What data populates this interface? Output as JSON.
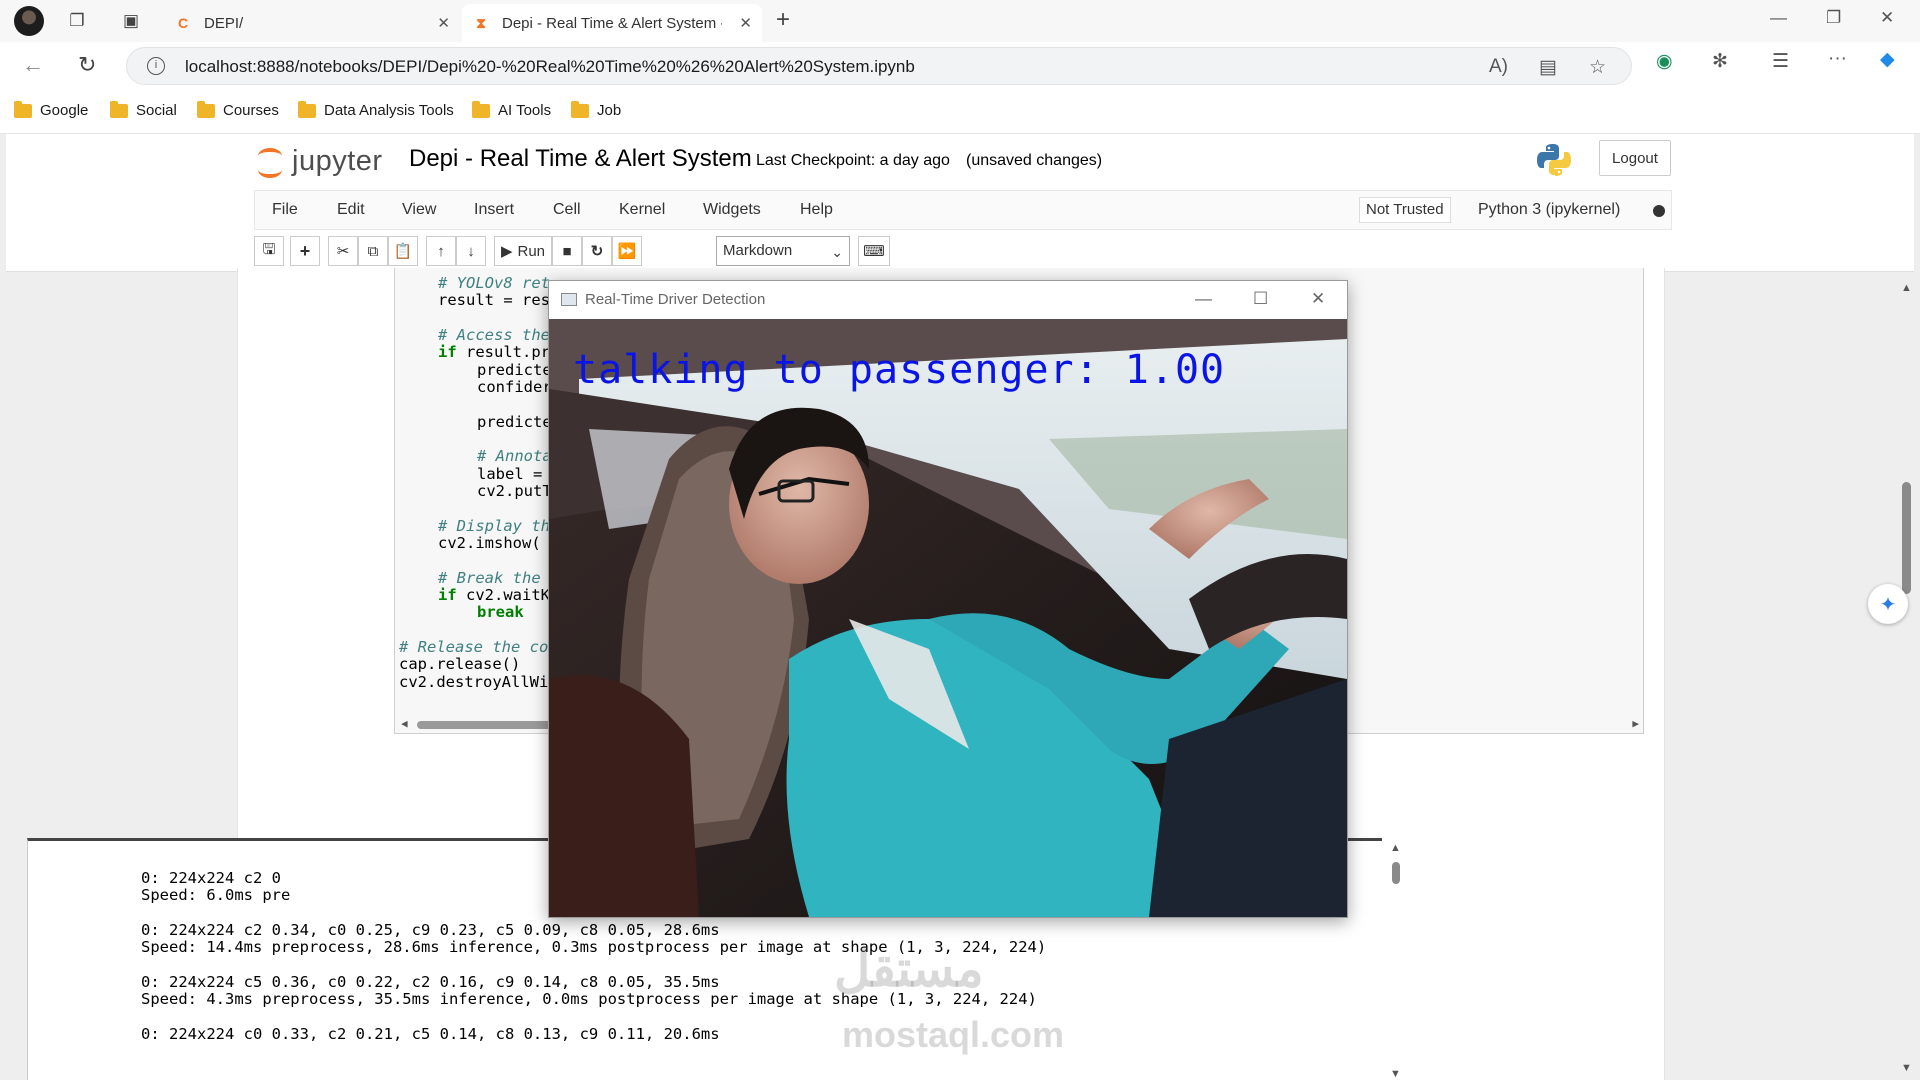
{
  "browser": {
    "tabs": [
      {
        "title": "DEPI/"
      },
      {
        "title": "Depi - Real Time & Alert System -"
      }
    ],
    "new_tab_symbol": "+",
    "url": "localhost:8888/notebooks/DEPI/Depi%20-%20Real%20Time%20%26%20Alert%20System.ipynb",
    "bookmarks": [
      "Google",
      "Social",
      "Courses",
      "Data Analysis Tools",
      "AI Tools",
      "Job"
    ]
  },
  "jupyter": {
    "logo_text": "jupyter",
    "notebook_title": "Depi - Real Time & Alert System",
    "checkpoint": "Last Checkpoint: a day ago",
    "unsaved": "(unsaved changes)",
    "logout": "Logout",
    "menu": [
      "File",
      "Edit",
      "View",
      "Insert",
      "Cell",
      "Kernel",
      "Widgets",
      "Help"
    ],
    "trust_status": "Not Trusted",
    "kernel_name": "Python 3 (ipykernel)",
    "toolbar": {
      "run_label": "Run",
      "cell_type": "Markdown"
    }
  },
  "code": {
    "lines": [
      {
        "text": "# YOLOv8 ret",
        "cls": "cm",
        "indent": 1
      },
      {
        "text": "result = res",
        "cls": "",
        "indent": 1
      },
      {
        "text": "",
        "cls": "",
        "indent": 0
      },
      {
        "text": "# Access the",
        "cls": "cm",
        "indent": 1
      },
      {
        "text": "if result.pr",
        "cls": "kwif",
        "indent": 1
      },
      {
        "text": "predicte",
        "cls": "",
        "indent": 2
      },
      {
        "text": "confider",
        "cls": "",
        "indent": 2
      },
      {
        "text": "",
        "cls": "",
        "indent": 0
      },
      {
        "text": "predicte",
        "cls": "",
        "indent": 2
      },
      {
        "text": "",
        "cls": "",
        "indent": 0
      },
      {
        "text": "# Annota",
        "cls": "cm",
        "indent": 2
      },
      {
        "text": "label = ",
        "cls": "",
        "indent": 2
      },
      {
        "text": "cv2.putT",
        "cls": "",
        "indent": 2
      },
      {
        "text": "",
        "cls": "",
        "indent": 0
      },
      {
        "text": "# Display th",
        "cls": "cm",
        "indent": 1
      },
      {
        "text": "cv2.imshow(",
        "cls": "",
        "indent": 1
      },
      {
        "text": "",
        "cls": "",
        "indent": 0
      },
      {
        "text": "# Break the",
        "cls": "cm",
        "indent": 1
      },
      {
        "text": "if cv2.waitK",
        "cls": "kwif",
        "indent": 1
      },
      {
        "text": "break",
        "cls": "kw",
        "indent": 2
      },
      {
        "text": "",
        "cls": "",
        "indent": 0
      },
      {
        "text": "# Release the co",
        "cls": "cm",
        "indent": 0
      },
      {
        "text": "cap.release()",
        "cls": "",
        "indent": 0
      },
      {
        "text": "cv2.destroyAllWi",
        "cls": "",
        "indent": 0
      }
    ]
  },
  "output": {
    "lines": [
      "0: 224x224 c2 0",
      "Speed: 6.0ms pre",
      "",
      "0: 224x224 c2 0.34, c0 0.25, c9 0.23, c5 0.09, c8 0.05, 28.6ms",
      "Speed: 14.4ms preprocess, 28.6ms inference, 0.3ms postprocess per image at shape (1, 3, 224, 224)",
      "",
      "0: 224x224 c5 0.36, c0 0.22, c2 0.16, c9 0.14, c8 0.05, 35.5ms",
      "Speed: 4.3ms preprocess, 35.5ms inference, 0.0ms postprocess per image at shape (1, 3, 224, 224)",
      "",
      "0: 224x224 c0 0.33, c2 0.21, c5 0.14, c8 0.13, c9 0.11, 20.6ms"
    ]
  },
  "cv_window": {
    "title": "Real-Time Driver Detection",
    "overlay_label": "talking to passenger: 1.00",
    "overlay_color": "#0a14e6"
  },
  "watermark": {
    "line1": "مستقل",
    "line2": "mostaql.com"
  }
}
